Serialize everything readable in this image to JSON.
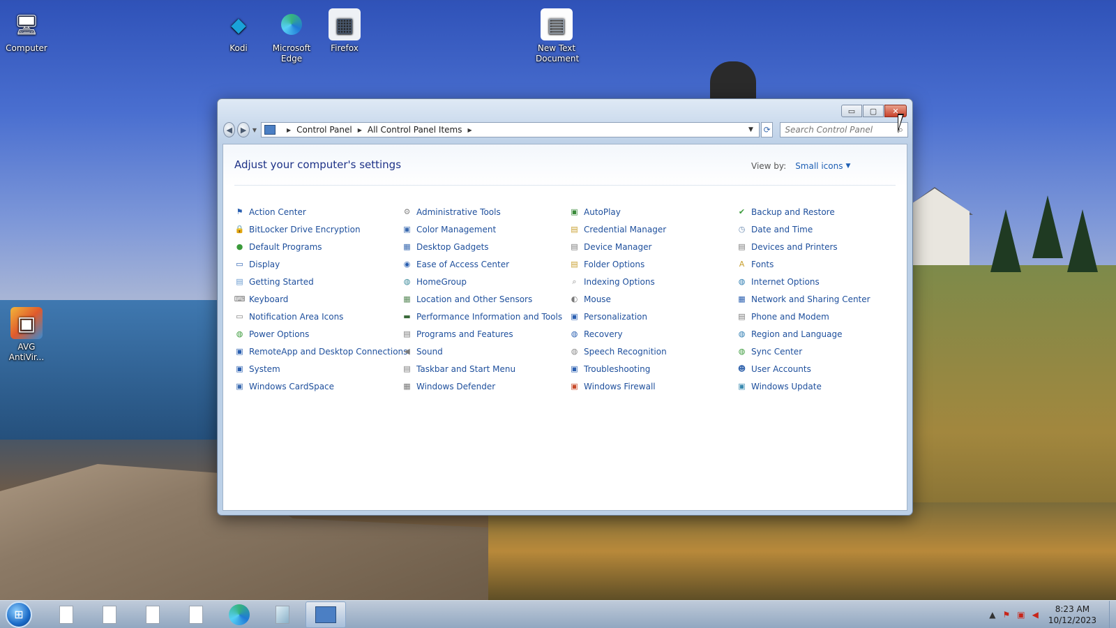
{
  "desktop": {
    "icons": [
      {
        "label": "Computer",
        "glyph": "🖥",
        "color": "#3d6cb0",
        "icon": "computer-icon"
      },
      {
        "label": "Kodi",
        "glyph": "◆",
        "color": "#1aa2d9",
        "icon": "kodi-icon"
      },
      {
        "label": "Microsoft Edge",
        "glyph": "e",
        "color": "#1f7ad6",
        "icon": "edge-icon"
      },
      {
        "label": "Firefox",
        "glyph": "▦",
        "color": "#6f7f96",
        "icon": "firefox-shortcut-icon"
      },
      {
        "label": "New Text Document",
        "glyph": "▤",
        "color": "#c7cfd9",
        "icon": "text-document-icon"
      },
      {
        "label": "AVG AntiVir...",
        "glyph": "▣",
        "color": "#e05a2c",
        "icon": "avg-antivirus-icon"
      }
    ]
  },
  "window": {
    "buttons": {
      "minimize": "▭",
      "maximize": "▢",
      "close": "✕"
    },
    "breadcrumb": [
      "Control Panel",
      "All Control Panel Items"
    ],
    "search_placeholder": "Search Control Panel",
    "title": "Adjust your computer's settings",
    "view_by_label": "View by:",
    "view_by_value": "Small icons"
  },
  "items": [
    {
      "label": "Action Center",
      "glyph": "⚑",
      "color": "#2a5fb0"
    },
    {
      "label": "Administrative Tools",
      "glyph": "⚙",
      "color": "#8a8a8a"
    },
    {
      "label": "AutoPlay",
      "glyph": "▣",
      "color": "#3a8a3a"
    },
    {
      "label": "Backup and Restore",
      "glyph": "✔",
      "color": "#3a9a3a"
    },
    {
      "label": "BitLocker Drive Encryption",
      "glyph": "🔒",
      "color": "#c89a2a"
    },
    {
      "label": "Color Management",
      "glyph": "▣",
      "color": "#3a6ab0"
    },
    {
      "label": "Credential Manager",
      "glyph": "▤",
      "color": "#c8a030"
    },
    {
      "label": "Date and Time",
      "glyph": "◷",
      "color": "#6a8ab0"
    },
    {
      "label": "Default Programs",
      "glyph": "●",
      "color": "#3a9a3a"
    },
    {
      "label": "Desktop Gadgets",
      "glyph": "▦",
      "color": "#3a6ab0"
    },
    {
      "label": "Device Manager",
      "glyph": "▤",
      "color": "#7a7a7a"
    },
    {
      "label": "Devices and Printers",
      "glyph": "▤",
      "color": "#7a7a7a"
    },
    {
      "label": "Display",
      "glyph": "▭",
      "color": "#2a5fb0"
    },
    {
      "label": "Ease of Access Center",
      "glyph": "◉",
      "color": "#2a5fb0"
    },
    {
      "label": "Folder Options",
      "glyph": "▤",
      "color": "#c8a030"
    },
    {
      "label": "Fonts",
      "glyph": "A",
      "color": "#c8a030"
    },
    {
      "label": "Getting Started",
      "glyph": "▤",
      "color": "#6a9ad0"
    },
    {
      "label": "HomeGroup",
      "glyph": "◍",
      "color": "#3a8a9a"
    },
    {
      "label": "Indexing Options",
      "glyph": "⌕",
      "color": "#8a8a8a"
    },
    {
      "label": "Internet Options",
      "glyph": "◍",
      "color": "#2a7ab0"
    },
    {
      "label": "Keyboard",
      "glyph": "⌨",
      "color": "#7a7a7a"
    },
    {
      "label": "Location and Other Sensors",
      "glyph": "▦",
      "color": "#5a8a5a"
    },
    {
      "label": "Mouse",
      "glyph": "◐",
      "color": "#7a7a7a"
    },
    {
      "label": "Network and Sharing Center",
      "glyph": "▦",
      "color": "#2a5fb0"
    },
    {
      "label": "Notification Area Icons",
      "glyph": "▭",
      "color": "#7a7a7a"
    },
    {
      "label": "Performance Information and Tools",
      "glyph": "▬",
      "color": "#3a6a3a"
    },
    {
      "label": "Personalization",
      "glyph": "▣",
      "color": "#2a5fb0"
    },
    {
      "label": "Phone and Modem",
      "glyph": "▤",
      "color": "#7a7a7a"
    },
    {
      "label": "Power Options",
      "glyph": "◍",
      "color": "#3a9a3a"
    },
    {
      "label": "Programs and Features",
      "glyph": "▤",
      "color": "#7a7a7a"
    },
    {
      "label": "Recovery",
      "glyph": "◍",
      "color": "#2a5fb0"
    },
    {
      "label": "Region and Language",
      "glyph": "◍",
      "color": "#2a7ab0"
    },
    {
      "label": "RemoteApp and Desktop Connections",
      "glyph": "▣",
      "color": "#2a5fb0"
    },
    {
      "label": "Sound",
      "glyph": "◀",
      "color": "#7a7a7a"
    },
    {
      "label": "Speech Recognition",
      "glyph": "◍",
      "color": "#8a8a8a"
    },
    {
      "label": "Sync Center",
      "glyph": "◍",
      "color": "#3a9a3a"
    },
    {
      "label": "System",
      "glyph": "▣",
      "color": "#2a5fb0"
    },
    {
      "label": "Taskbar and Start Menu",
      "glyph": "▤",
      "color": "#7a7a7a"
    },
    {
      "label": "Troubleshooting",
      "glyph": "▣",
      "color": "#2a5fb0"
    },
    {
      "label": "User Accounts",
      "glyph": "☻",
      "color": "#3a6ab0"
    },
    {
      "label": "Windows CardSpace",
      "glyph": "▣",
      "color": "#3a6ab0"
    },
    {
      "label": "Windows Defender",
      "glyph": "▦",
      "color": "#7a7a7a"
    },
    {
      "label": "Windows Firewall",
      "glyph": "▣",
      "color": "#c84a2a"
    },
    {
      "label": "Windows Update",
      "glyph": "▣",
      "color": "#3a8ab0"
    }
  ],
  "taskbar": {
    "clock_time": "8:23 AM",
    "clock_date": "10/12/2023",
    "tray_arrow": "▲"
  }
}
